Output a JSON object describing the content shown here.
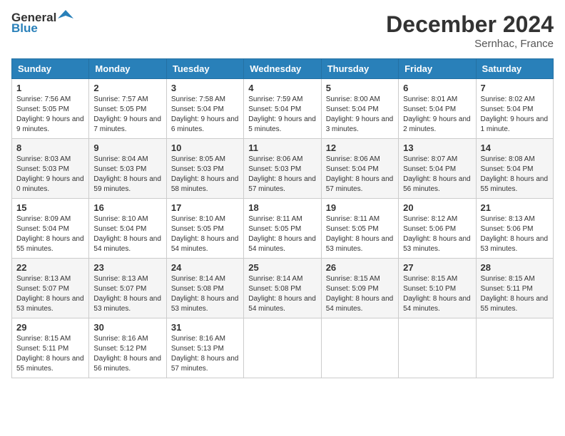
{
  "header": {
    "logo_general": "General",
    "logo_blue": "Blue",
    "month_year": "December 2024",
    "location": "Sernhac, France"
  },
  "days_of_week": [
    "Sunday",
    "Monday",
    "Tuesday",
    "Wednesday",
    "Thursday",
    "Friday",
    "Saturday"
  ],
  "weeks": [
    [
      {
        "day": "1",
        "content": "Sunrise: 7:56 AM\nSunset: 5:05 PM\nDaylight: 9 hours and 9 minutes."
      },
      {
        "day": "2",
        "content": "Sunrise: 7:57 AM\nSunset: 5:05 PM\nDaylight: 9 hours and 7 minutes."
      },
      {
        "day": "3",
        "content": "Sunrise: 7:58 AM\nSunset: 5:04 PM\nDaylight: 9 hours and 6 minutes."
      },
      {
        "day": "4",
        "content": "Sunrise: 7:59 AM\nSunset: 5:04 PM\nDaylight: 9 hours and 5 minutes."
      },
      {
        "day": "5",
        "content": "Sunrise: 8:00 AM\nSunset: 5:04 PM\nDaylight: 9 hours and 3 minutes."
      },
      {
        "day": "6",
        "content": "Sunrise: 8:01 AM\nSunset: 5:04 PM\nDaylight: 9 hours and 2 minutes."
      },
      {
        "day": "7",
        "content": "Sunrise: 8:02 AM\nSunset: 5:04 PM\nDaylight: 9 hours and 1 minute."
      }
    ],
    [
      {
        "day": "8",
        "content": "Sunrise: 8:03 AM\nSunset: 5:03 PM\nDaylight: 9 hours and 0 minutes."
      },
      {
        "day": "9",
        "content": "Sunrise: 8:04 AM\nSunset: 5:03 PM\nDaylight: 8 hours and 59 minutes."
      },
      {
        "day": "10",
        "content": "Sunrise: 8:05 AM\nSunset: 5:03 PM\nDaylight: 8 hours and 58 minutes."
      },
      {
        "day": "11",
        "content": "Sunrise: 8:06 AM\nSunset: 5:03 PM\nDaylight: 8 hours and 57 minutes."
      },
      {
        "day": "12",
        "content": "Sunrise: 8:06 AM\nSunset: 5:04 PM\nDaylight: 8 hours and 57 minutes."
      },
      {
        "day": "13",
        "content": "Sunrise: 8:07 AM\nSunset: 5:04 PM\nDaylight: 8 hours and 56 minutes."
      },
      {
        "day": "14",
        "content": "Sunrise: 8:08 AM\nSunset: 5:04 PM\nDaylight: 8 hours and 55 minutes."
      }
    ],
    [
      {
        "day": "15",
        "content": "Sunrise: 8:09 AM\nSunset: 5:04 PM\nDaylight: 8 hours and 55 minutes."
      },
      {
        "day": "16",
        "content": "Sunrise: 8:10 AM\nSunset: 5:04 PM\nDaylight: 8 hours and 54 minutes."
      },
      {
        "day": "17",
        "content": "Sunrise: 8:10 AM\nSunset: 5:05 PM\nDaylight: 8 hours and 54 minutes."
      },
      {
        "day": "18",
        "content": "Sunrise: 8:11 AM\nSunset: 5:05 PM\nDaylight: 8 hours and 54 minutes."
      },
      {
        "day": "19",
        "content": "Sunrise: 8:11 AM\nSunset: 5:05 PM\nDaylight: 8 hours and 53 minutes."
      },
      {
        "day": "20",
        "content": "Sunrise: 8:12 AM\nSunset: 5:06 PM\nDaylight: 8 hours and 53 minutes."
      },
      {
        "day": "21",
        "content": "Sunrise: 8:13 AM\nSunset: 5:06 PM\nDaylight: 8 hours and 53 minutes."
      }
    ],
    [
      {
        "day": "22",
        "content": "Sunrise: 8:13 AM\nSunset: 5:07 PM\nDaylight: 8 hours and 53 minutes."
      },
      {
        "day": "23",
        "content": "Sunrise: 8:13 AM\nSunset: 5:07 PM\nDaylight: 8 hours and 53 minutes."
      },
      {
        "day": "24",
        "content": "Sunrise: 8:14 AM\nSunset: 5:08 PM\nDaylight: 8 hours and 53 minutes."
      },
      {
        "day": "25",
        "content": "Sunrise: 8:14 AM\nSunset: 5:08 PM\nDaylight: 8 hours and 54 minutes."
      },
      {
        "day": "26",
        "content": "Sunrise: 8:15 AM\nSunset: 5:09 PM\nDaylight: 8 hours and 54 minutes."
      },
      {
        "day": "27",
        "content": "Sunrise: 8:15 AM\nSunset: 5:10 PM\nDaylight: 8 hours and 54 minutes."
      },
      {
        "day": "28",
        "content": "Sunrise: 8:15 AM\nSunset: 5:11 PM\nDaylight: 8 hours and 55 minutes."
      }
    ],
    [
      {
        "day": "29",
        "content": "Sunrise: 8:15 AM\nSunset: 5:11 PM\nDaylight: 8 hours and 55 minutes."
      },
      {
        "day": "30",
        "content": "Sunrise: 8:16 AM\nSunset: 5:12 PM\nDaylight: 8 hours and 56 minutes."
      },
      {
        "day": "31",
        "content": "Sunrise: 8:16 AM\nSunset: 5:13 PM\nDaylight: 8 hours and 57 minutes."
      },
      {
        "day": "",
        "content": ""
      },
      {
        "day": "",
        "content": ""
      },
      {
        "day": "",
        "content": ""
      },
      {
        "day": "",
        "content": ""
      }
    ]
  ]
}
